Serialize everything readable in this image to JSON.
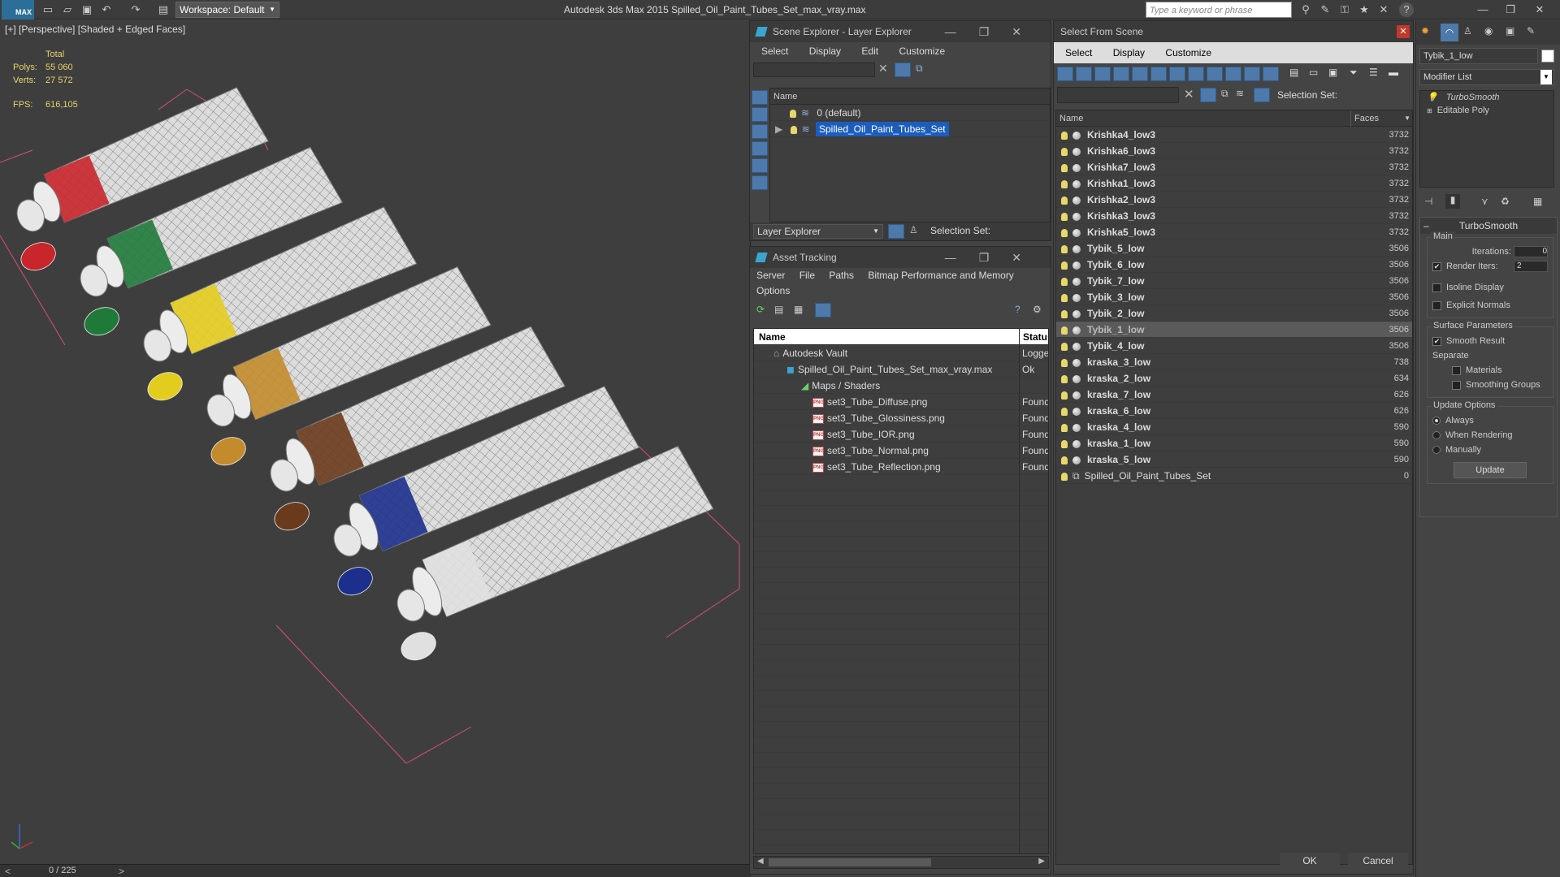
{
  "app": {
    "title": "Autodesk 3ds Max  2015     Spilled_Oil_Paint_Tubes_Set_max_vray.max",
    "logo": "MAX",
    "workspace": "Workspace: Default",
    "search_placeholder": "Type a keyword or phrase"
  },
  "viewport": {
    "label": "[+] [Perspective] [Shaded + Edged Faces]",
    "stats": {
      "total_label": "Total",
      "polys_label": "Polys:",
      "polys_value": "55 060",
      "verts_label": "Verts:",
      "verts_value": "27 572",
      "fps_label": "FPS:",
      "fps_value": "616,105"
    },
    "tubes": [
      {
        "cap_color": "#c8262b"
      },
      {
        "cap_color": "#1f7a3a"
      },
      {
        "cap_color": "#e4cc1e"
      },
      {
        "cap_color": "#c38b2c"
      },
      {
        "cap_color": "#6a3a1c"
      },
      {
        "cap_color": "#1d2f8c"
      },
      {
        "cap_color": "#e0e0e0"
      }
    ]
  },
  "timeline": {
    "frame": "0 / 225",
    "prev": "<",
    "next": ">"
  },
  "scene_explorer": {
    "title": "Scene Explorer - Layer Explorer",
    "menu": [
      "Select",
      "Display",
      "Edit",
      "Customize"
    ],
    "column_name": "Name",
    "rows": [
      {
        "label": "0 (default)"
      },
      {
        "label": "Spilled_Oil_Paint_Tubes_Set"
      }
    ],
    "footer_dropdown": "Layer Explorer",
    "selection_set_label": "Selection Set:"
  },
  "asset_tracking": {
    "title": "Asset Tracking",
    "menu": [
      "Server",
      "File",
      "Paths",
      "Bitmap Performance and Memory"
    ],
    "menu2": "Options",
    "col_name": "Name",
    "col_status": "Status",
    "rows": [
      {
        "name": "Autodesk Vault",
        "status": "Logged"
      },
      {
        "name": "Spilled_Oil_Paint_Tubes_Set_max_vray.max",
        "status": "Ok"
      },
      {
        "name": "Maps / Shaders",
        "status": ""
      },
      {
        "name": "set3_Tube_Diffuse.png",
        "status": "Found"
      },
      {
        "name": "set3_Tube_Glossiness.png",
        "status": "Found"
      },
      {
        "name": "set3_Tube_IOR.png",
        "status": "Found"
      },
      {
        "name": "set3_Tube_Normal.png",
        "status": "Found"
      },
      {
        "name": "set3_Tube_Reflection.png",
        "status": "Found"
      }
    ]
  },
  "select_from_scene": {
    "title": "Select From Scene",
    "menu": [
      "Select",
      "Display",
      "Customize"
    ],
    "selection_set_label": "Selection Set:",
    "col_name": "Name",
    "col_faces": "Faces",
    "rows": [
      {
        "name": "Krishka4_low3",
        "faces": "3732"
      },
      {
        "name": "Krishka6_low3",
        "faces": "3732"
      },
      {
        "name": "Krishka7_low3",
        "faces": "3732"
      },
      {
        "name": "Krishka1_low3",
        "faces": "3732"
      },
      {
        "name": "Krishka2_low3",
        "faces": "3732"
      },
      {
        "name": "Krishka3_low3",
        "faces": "3732"
      },
      {
        "name": "Krishka5_low3",
        "faces": "3732"
      },
      {
        "name": "Tybik_5_low",
        "faces": "3506"
      },
      {
        "name": "Tybik_6_low",
        "faces": "3506"
      },
      {
        "name": "Tybik_7_low",
        "faces": "3506"
      },
      {
        "name": "Tybik_3_low",
        "faces": "3506"
      },
      {
        "name": "Tybik_2_low",
        "faces": "3506"
      },
      {
        "name": "Tybik_1_low",
        "faces": "3506"
      },
      {
        "name": "Tybik_4_low",
        "faces": "3506"
      },
      {
        "name": "kraska_3_low",
        "faces": "738"
      },
      {
        "name": "kraska_2_low",
        "faces": "634"
      },
      {
        "name": "kraska_7_low",
        "faces": "626"
      },
      {
        "name": "kraska_6_low",
        "faces": "626"
      },
      {
        "name": "kraska_4_low",
        "faces": "590"
      },
      {
        "name": "kraska_1_low",
        "faces": "590"
      },
      {
        "name": "kraska_5_low",
        "faces": "590"
      },
      {
        "name": "Spilled_Oil_Paint_Tubes_Set",
        "faces": "0"
      }
    ],
    "ok": "OK",
    "cancel": "Cancel"
  },
  "modify_panel": {
    "object_name": "Tybik_1_low",
    "modifier_list": "Modifier List",
    "stack": [
      "TurboSmooth",
      "Editable Poly"
    ],
    "rollout_title": "TurboSmooth",
    "main_label": "Main",
    "iterations_label": "Iterations:",
    "iterations_value": "0",
    "render_iters_label": "Render Iters:",
    "render_iters_value": "2",
    "isoline_label": "Isoline Display",
    "explicit_normals_label": "Explicit Normals",
    "surface_label": "Surface Parameters",
    "smooth_result_label": "Smooth Result",
    "separate_label": "Separate",
    "materials_label": "Materials",
    "smoothing_groups_label": "Smoothing Groups",
    "update_options_label": "Update Options",
    "always_label": "Always",
    "when_rendering_label": "When Rendering",
    "manually_label": "Manually",
    "update_button": "Update"
  },
  "colors": {
    "selection": "#1c5dbc",
    "stat_text": "#e8d46a",
    "bbox": "#d94f76"
  }
}
